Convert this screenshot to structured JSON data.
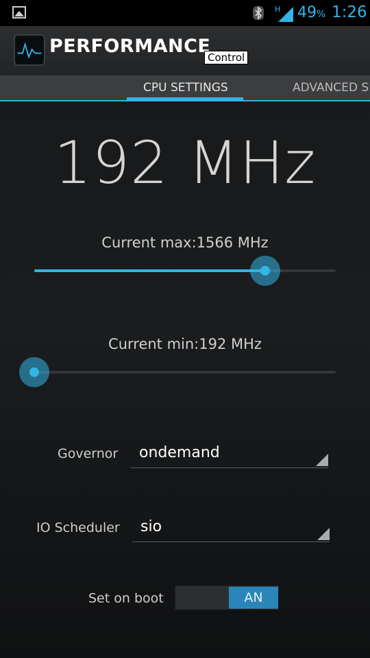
{
  "status_bar": {
    "battery_text": "49",
    "battery_unit": "%",
    "time": "1:26",
    "network_label": "H",
    "icons": [
      "image-notification-icon",
      "bluetooth-icon",
      "signal-icon"
    ]
  },
  "app": {
    "title_main": "PERFORMANCE",
    "title_sub": "Control",
    "icon": "pulse-monitor-icon"
  },
  "tabs": [
    {
      "label": "CPU SETTINGS",
      "active": true
    },
    {
      "label": "ADVANCED SE",
      "active": false
    }
  ],
  "cpu": {
    "current_freq": "192 MHz",
    "max_label": "Current max:1566 MHz",
    "max_slider_fraction": 0.767,
    "min_label": "Current min:192 MHz",
    "min_slider_fraction": 0.0
  },
  "governor": {
    "label": "Governor",
    "value": "ondemand"
  },
  "io_scheduler": {
    "label": "IO Scheduler",
    "value": "sio"
  },
  "set_on_boot": {
    "label": "Set on boot",
    "state": "AN"
  },
  "colors": {
    "accent": "#33b5e5"
  }
}
